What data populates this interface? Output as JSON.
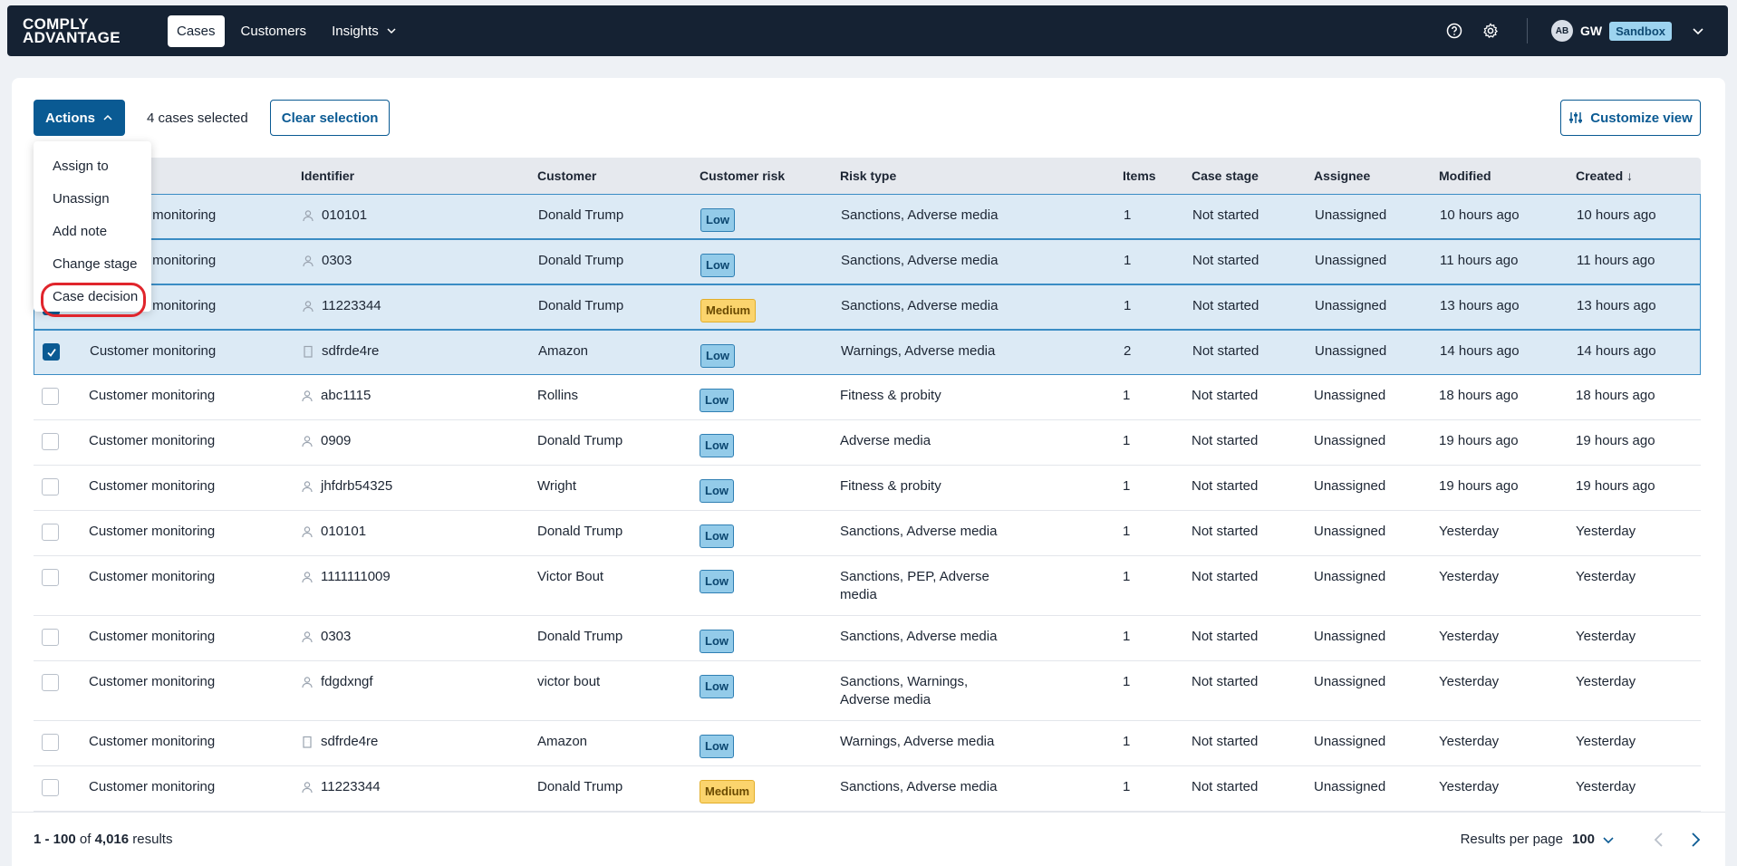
{
  "logo": {
    "line1": "COMPLY",
    "line2": "ADVANTAGE"
  },
  "nav": [
    {
      "label": "Cases",
      "active": true
    },
    {
      "label": "Customers",
      "active": false
    },
    {
      "label": "Insights",
      "active": false,
      "has_dropdown": true
    }
  ],
  "header": {
    "help_icon": "help-circle-icon",
    "settings_icon": "gear-icon",
    "avatar": "AB",
    "user": "GW",
    "environment": "Sandbox"
  },
  "toolbar": {
    "actions_label": "Actions",
    "selected_text": "4 cases selected",
    "clear_label": "Clear selection",
    "customize_label": "Customize view"
  },
  "menu": {
    "items": [
      "Assign to",
      "Unassign",
      "Add note",
      "Change stage",
      "Case decision"
    ],
    "highlighted": "Case decision"
  },
  "table": {
    "columns": [
      "",
      "",
      "Identifier",
      "Customer",
      "Customer risk",
      "Risk type",
      "Items",
      "Case stage",
      "Assignee",
      "Modified",
      "Created ↓"
    ],
    "rows": [
      {
        "selected": true,
        "type": "Customer monitoring",
        "id_icon": "person-icon",
        "identifier": "010101",
        "customer": "Donald Trump",
        "risk": "Low",
        "risk_type": "Sanctions, Adverse media",
        "items": "1",
        "stage": "Not started",
        "assignee": "Unassigned",
        "modified": "10 hours ago",
        "created": "10 hours ago"
      },
      {
        "selected": true,
        "type": "Customer monitoring",
        "id_icon": "person-icon",
        "identifier": "0303",
        "customer": "Donald Trump",
        "risk": "Low",
        "risk_type": "Sanctions, Adverse media",
        "items": "1",
        "stage": "Not started",
        "assignee": "Unassigned",
        "modified": "11 hours ago",
        "created": "11 hours ago"
      },
      {
        "selected": true,
        "type": "Customer monitoring",
        "id_icon": "person-icon",
        "identifier": "11223344",
        "customer": "Donald Trump",
        "risk": "Medium",
        "risk_type": "Sanctions, Adverse media",
        "items": "1",
        "stage": "Not started",
        "assignee": "Unassigned",
        "modified": "13 hours ago",
        "created": "13 hours ago"
      },
      {
        "selected": true,
        "type": "Customer monitoring",
        "id_icon": "building-icon",
        "identifier": "sdfrde4re",
        "customer": "Amazon",
        "risk": "Low",
        "risk_type": "Warnings, Adverse media",
        "items": "2",
        "stage": "Not started",
        "assignee": "Unassigned",
        "modified": "14 hours ago",
        "created": "14 hours ago"
      },
      {
        "selected": false,
        "type": "Customer monitoring",
        "id_icon": "person-icon",
        "identifier": "abc1115",
        "customer": "Rollins",
        "risk": "Low",
        "risk_type": "Fitness & probity",
        "items": "1",
        "stage": "Not started",
        "assignee": "Unassigned",
        "modified": "18 hours ago",
        "created": "18 hours ago"
      },
      {
        "selected": false,
        "type": "Customer monitoring",
        "id_icon": "person-icon",
        "identifier": "0909",
        "customer": "Donald Trump",
        "risk": "Low",
        "risk_type": "Adverse media",
        "items": "1",
        "stage": "Not started",
        "assignee": "Unassigned",
        "modified": "19 hours ago",
        "created": "19 hours ago"
      },
      {
        "selected": false,
        "type": "Customer monitoring",
        "id_icon": "person-icon",
        "identifier": "jhfdrb54325",
        "customer": "Wright",
        "risk": "Low",
        "risk_type": "Fitness & probity",
        "items": "1",
        "stage": "Not started",
        "assignee": "Unassigned",
        "modified": "19 hours ago",
        "created": "19 hours ago"
      },
      {
        "selected": false,
        "type": "Customer monitoring",
        "id_icon": "person-icon",
        "identifier": "010101",
        "customer": "Donald Trump",
        "risk": "Low",
        "risk_type": "Sanctions, Adverse media",
        "items": "1",
        "stage": "Not started",
        "assignee": "Unassigned",
        "modified": "Yesterday",
        "created": "Yesterday"
      },
      {
        "selected": false,
        "type": "Customer monitoring",
        "id_icon": "person-icon",
        "identifier": "1111111009",
        "customer": "Victor Bout",
        "risk": "Low",
        "risk_type": "Sanctions, PEP, Adverse media",
        "items": "1",
        "stage": "Not started",
        "assignee": "Unassigned",
        "modified": "Yesterday",
        "created": "Yesterday"
      },
      {
        "selected": false,
        "type": "Customer monitoring",
        "id_icon": "person-icon",
        "identifier": "0303",
        "customer": "Donald Trump",
        "risk": "Low",
        "risk_type": "Sanctions, Adverse media",
        "items": "1",
        "stage": "Not started",
        "assignee": "Unassigned",
        "modified": "Yesterday",
        "created": "Yesterday"
      },
      {
        "selected": false,
        "type": "Customer monitoring",
        "id_icon": "person-icon",
        "identifier": "fdgdxngf",
        "customer": "victor bout",
        "risk": "Low",
        "risk_type": "Sanctions, Warnings, Adverse media",
        "items": "1",
        "stage": "Not started",
        "assignee": "Unassigned",
        "modified": "Yesterday",
        "created": "Yesterday"
      },
      {
        "selected": false,
        "type": "Customer monitoring",
        "id_icon": "building-icon",
        "identifier": "sdfrde4re",
        "customer": "Amazon",
        "risk": "Low",
        "risk_type": "Warnings, Adverse media",
        "items": "1",
        "stage": "Not started",
        "assignee": "Unassigned",
        "modified": "Yesterday",
        "created": "Yesterday"
      },
      {
        "selected": false,
        "type": "Customer monitoring",
        "id_icon": "person-icon",
        "identifier": "11223344",
        "customer": "Donald Trump",
        "risk": "Medium",
        "risk_type": "Sanctions, Adverse media",
        "items": "1",
        "stage": "Not started",
        "assignee": "Unassigned",
        "modified": "Yesterday",
        "created": "Yesterday"
      }
    ]
  },
  "footer": {
    "range": "1 - 100",
    "of_word": "of",
    "total": "4,016",
    "results_word": "results",
    "per_page_label": "Results per page",
    "per_page_value": "100"
  }
}
